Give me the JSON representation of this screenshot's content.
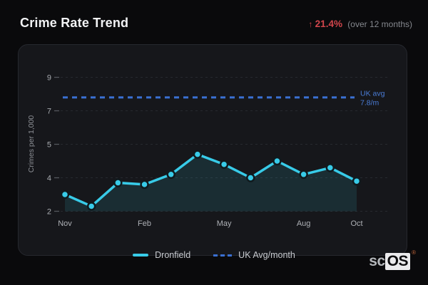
{
  "header": {
    "title": "Crime Rate Trend",
    "stat_arrow": "↑",
    "stat_value": "21.4%",
    "stat_context": "(over 12 months)"
  },
  "chart_data": {
    "type": "line",
    "title": "Crime Rate Trend",
    "xlabel": "",
    "ylabel": "Crimes per 1,000",
    "x_tick_labels": [
      "Nov",
      "Feb",
      "May",
      "Aug",
      "Oct"
    ],
    "x_tick_indices": [
      0,
      3,
      6,
      9,
      11
    ],
    "y_tick_labels": [
      9,
      7,
      5,
      4,
      2
    ],
    "grid": true,
    "legend_position": "bottom",
    "series": [
      {
        "name": "Dronfield",
        "style": "solid",
        "color": "#38cbe8",
        "values": [
          3.0,
          2.3,
          3.7,
          3.6,
          4.1,
          4.7,
          4.4,
          4.0,
          4.5,
          4.1,
          4.3,
          3.8
        ]
      },
      {
        "name": "UK Avg/month",
        "style": "dashed",
        "color": "#3a70d2",
        "avg_value": 7.8
      }
    ],
    "annotation": {
      "line1": "UK avg",
      "line2": "7.8/m",
      "color": "#4a7cd6"
    }
  },
  "colors": {
    "accent_cyan": "#38cbe8",
    "accent_blue": "#3a70d2",
    "stat_red": "#d0454b",
    "panel_bg": "#16171b",
    "page_bg": "#0a0a0c",
    "grid": "#272a30",
    "axis_text": "#a8abb0",
    "area_fill": "rgba(56,203,232,0.12)"
  },
  "branding": {
    "prefix": "sc",
    "boxed": "OS",
    "registered": "®"
  }
}
